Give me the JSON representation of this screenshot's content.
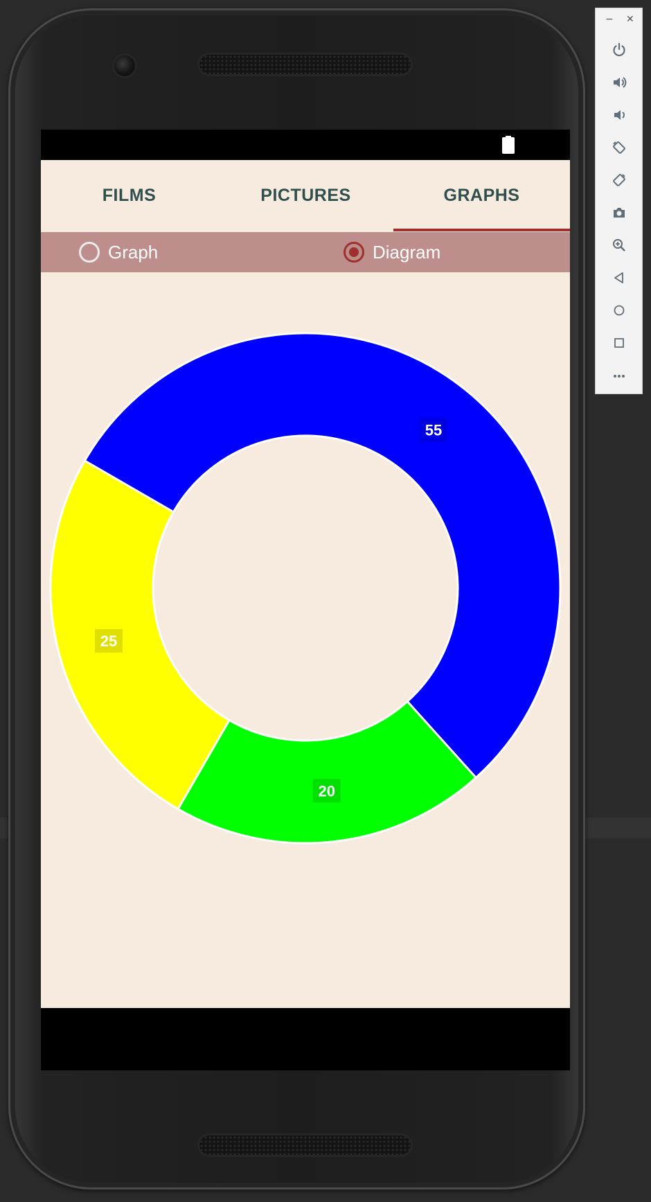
{
  "tabs": [
    {
      "label": "FILMS"
    },
    {
      "label": "PICTURES"
    },
    {
      "label": "GRAPHS"
    }
  ],
  "active_tab": "GRAPHS",
  "radio": {
    "options": [
      {
        "label": "Graph",
        "checked": false
      },
      {
        "label": "Diagram",
        "checked": true
      }
    ]
  },
  "status_bar": {
    "icons": [
      "battery-icon"
    ]
  },
  "colors": {
    "accent": "#a0302d",
    "tab_text": "#2f4f4f",
    "app_background": "#f7ebe0",
    "radio_bar": "#bd8e8b"
  },
  "emulator_toolbar": {
    "window_controls": [
      "minimize-icon",
      "close-icon"
    ],
    "buttons": [
      "power-icon",
      "volume-up-icon",
      "volume-down-icon",
      "rotate-left-icon",
      "rotate-right-icon",
      "camera-icon",
      "zoom-icon",
      "back-icon",
      "home-icon",
      "overview-icon",
      "more-icon"
    ]
  },
  "chart_data": {
    "type": "pie",
    "title": "",
    "donut": true,
    "categories": [
      "",
      "",
      ""
    ],
    "values": [
      55,
      20,
      25
    ],
    "labels": [
      "55",
      "20",
      "25"
    ],
    "colors": [
      "#0000ff",
      "#00ff00",
      "#ffff00"
    ],
    "legend": false
  }
}
